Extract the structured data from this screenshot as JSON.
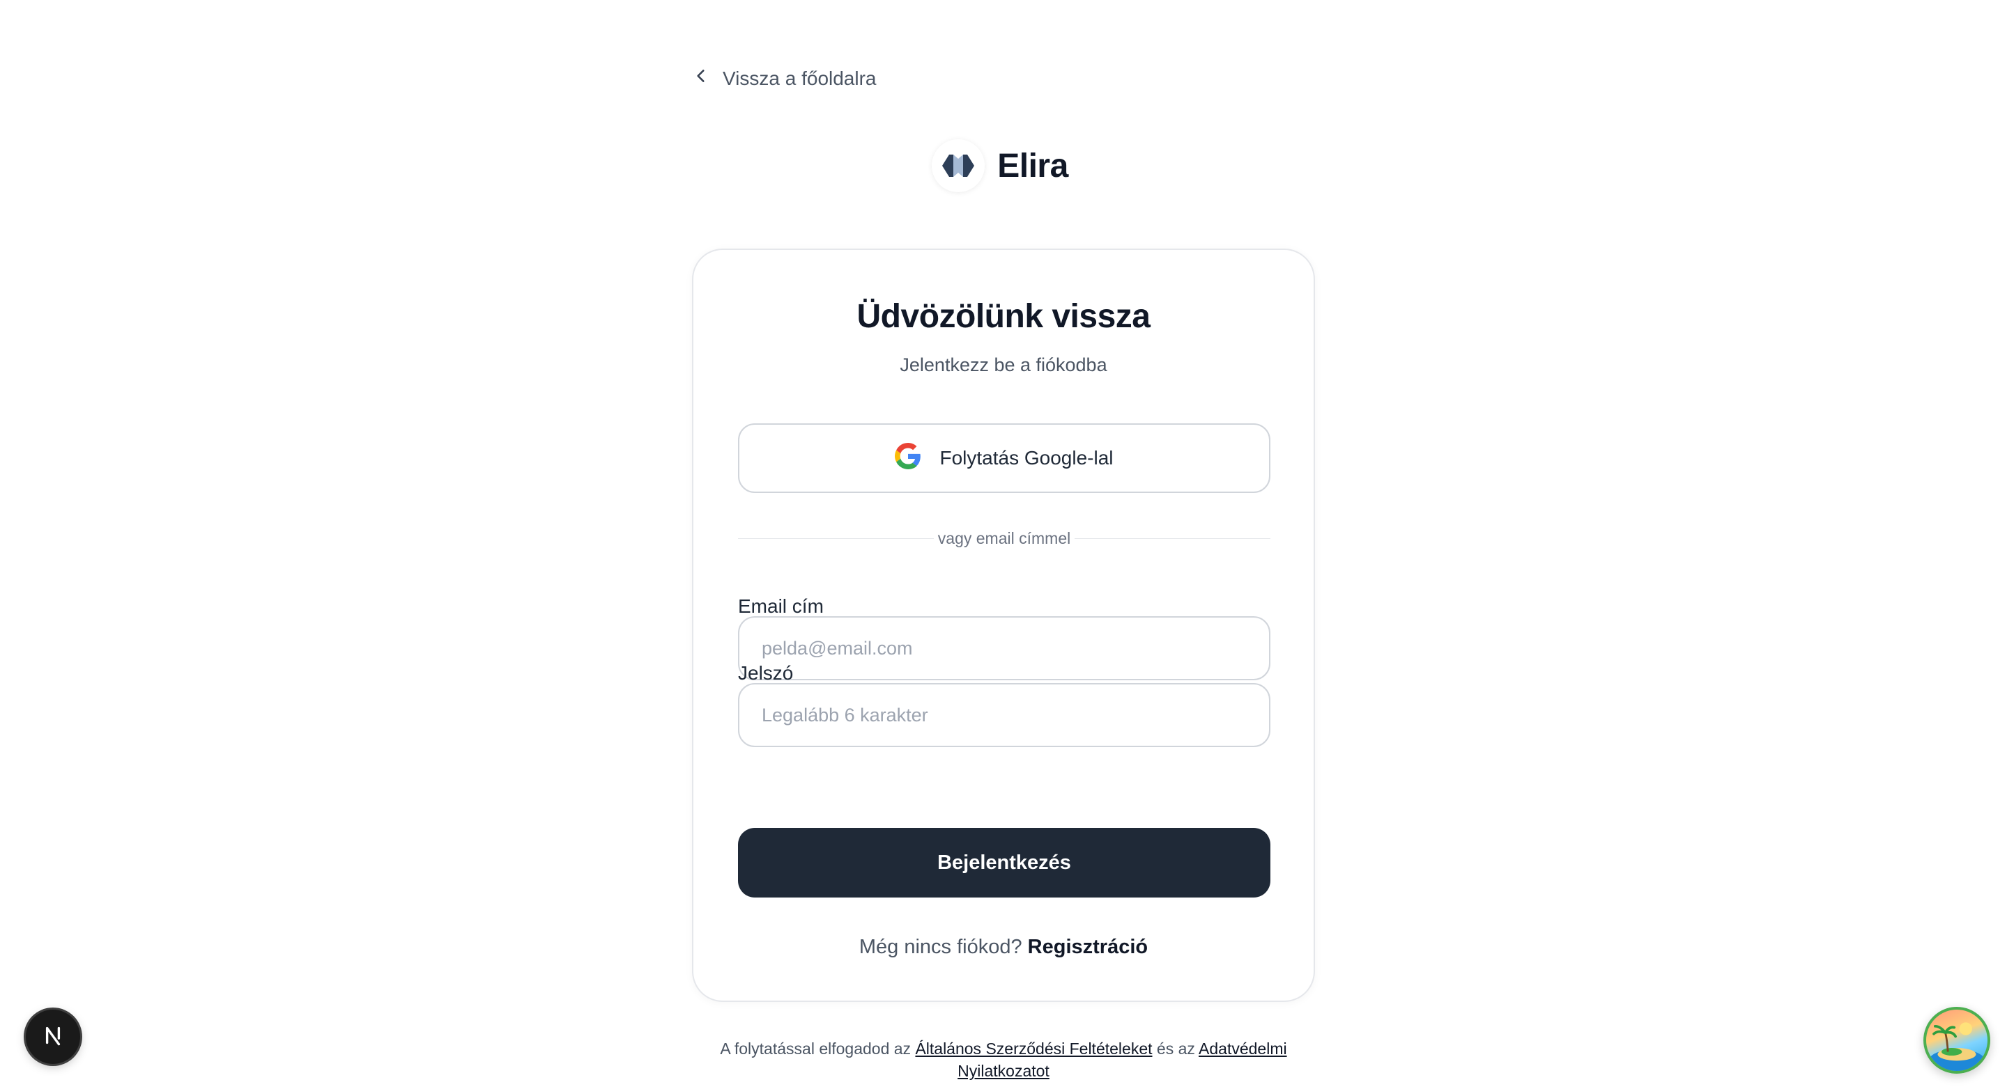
{
  "nav": {
    "back_label": "Vissza a főoldalra"
  },
  "brand": {
    "name": "Elira",
    "logo_icon": "elira-logo-icon"
  },
  "login": {
    "title": "Üdvözölünk vissza",
    "subtitle": "Jelentkezz be a fiókodba",
    "google_label": "Folytatás Google-lal",
    "divider_text": "vagy email címmel",
    "email_label": "Email cím",
    "email_placeholder": "pelda@email.com",
    "email_value": "",
    "password_label": "Jelszó",
    "password_placeholder": "Legalább 6 karakter",
    "password_value": "",
    "submit_label": "Bejelentkezés",
    "signup_prompt": "Még nincs fiókod?",
    "signup_link": "Regisztráció"
  },
  "terms": {
    "prefix": "A folytatással elfogadod az",
    "tos_link": "Általános Szerződési Feltételeket",
    "middle": "és az",
    "privacy_link": "Adatvédelmi Nyilatkozatot"
  },
  "colors": {
    "primary_button": "#1f2937",
    "text_dark": "#111827",
    "border": "#d1d5db"
  }
}
